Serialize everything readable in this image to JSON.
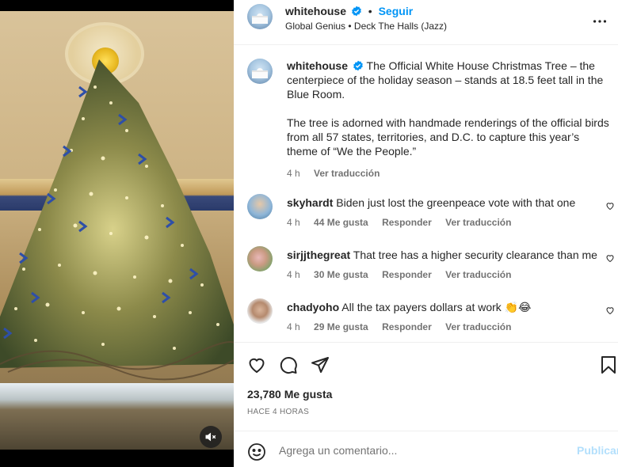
{
  "post": {
    "username": "whitehouse",
    "follow_label": "Seguir",
    "separator": "•",
    "music": "Global Genius • Deck The Halls (Jazz)"
  },
  "caption": {
    "username": "whitehouse",
    "paragraph1": "The Official White House Christmas Tree – the centerpiece of the holiday season – stands at 18.5 feet tall in the Blue Room.",
    "paragraph2": "The tree is adorned with handmade renderings of the official birds from all 57 states, territories, and D.C. to capture this year’s theme of “We the People.”",
    "time": "4 h",
    "translate": "Ver traducción"
  },
  "comments": [
    {
      "username": "skyhardt",
      "text": "Biden just lost the greenpeace vote with that one",
      "time": "4 h",
      "likes": "44 Me gusta",
      "reply": "Responder",
      "translate": "Ver traducción"
    },
    {
      "username": "sirjjthegreat",
      "text": "That tree has a higher security clearance than me",
      "time": "4 h",
      "likes": "30 Me gusta",
      "reply": "Responder",
      "translate": "Ver traducción"
    },
    {
      "username": "chadyoho",
      "text": "All the tax payers dollars at work 👏😂",
      "time": "4 h",
      "likes": "29 Me gusta",
      "reply": "Responder",
      "translate": "Ver traducción"
    }
  ],
  "stats": {
    "likes": "23,780 Me gusta",
    "posted": "HACE 4 HORAS"
  },
  "composer": {
    "placeholder": "Agrega un comentario...",
    "publish_label": "Publicar"
  },
  "colors": {
    "accent": "#0095f6",
    "publish_disabled": "#b2dffc",
    "verified": "#0095f6"
  },
  "icons": [
    "verified-icon",
    "more-icon",
    "heart-icon",
    "comment-icon",
    "share-icon",
    "save-icon",
    "emoji-icon",
    "mute-icon"
  ]
}
